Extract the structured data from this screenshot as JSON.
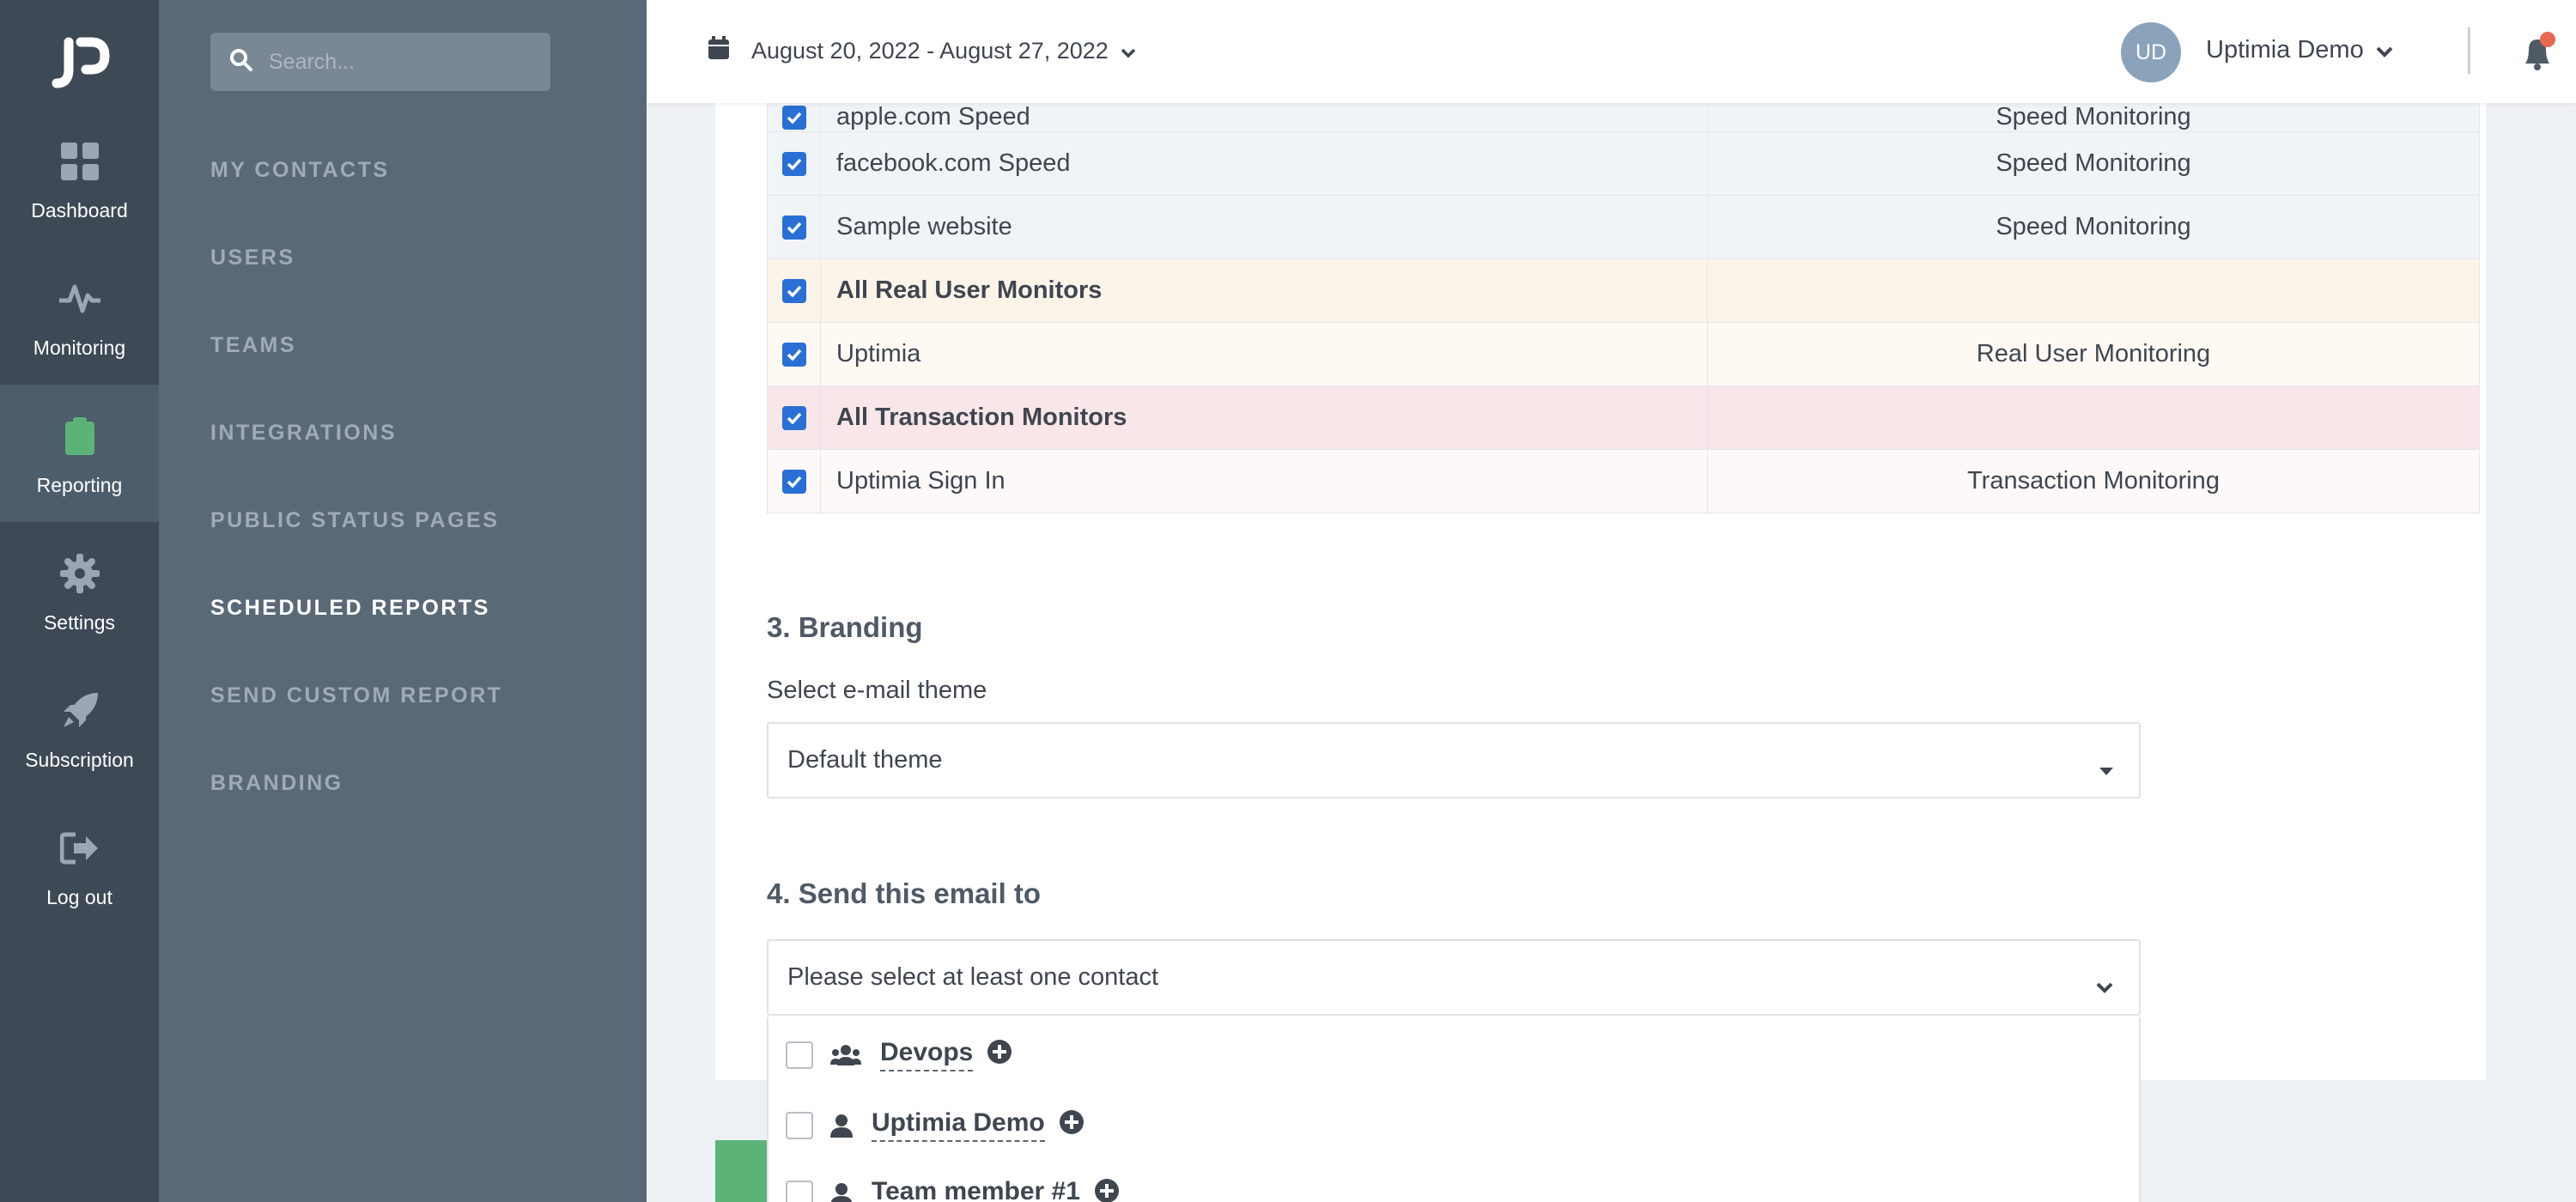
{
  "rail": {
    "items": [
      {
        "label": "Dashboard",
        "icon": "dashboard-icon"
      },
      {
        "label": "Monitoring",
        "icon": "pulse-icon"
      },
      {
        "label": "Reporting",
        "icon": "clipboard-icon"
      },
      {
        "label": "Settings",
        "icon": "gear-icon"
      },
      {
        "label": "Subscription",
        "icon": "rocket-icon"
      },
      {
        "label": "Log out",
        "icon": "logout-icon"
      }
    ],
    "active": "Reporting"
  },
  "search": {
    "placeholder": "Search..."
  },
  "subnav": {
    "items": [
      "MY CONTACTS",
      "USERS",
      "TEAMS",
      "INTEGRATIONS",
      "PUBLIC STATUS PAGES",
      "SCHEDULED REPORTS",
      "SEND CUSTOM REPORT",
      "BRANDING"
    ],
    "active": "SCHEDULED REPORTS"
  },
  "topbar": {
    "date_range": "August 20, 2022 - August 27, 2022",
    "avatar_initials": "UD",
    "user_name": "Uptimia Demo"
  },
  "monitors": {
    "rows": [
      {
        "name": "apple.com Speed",
        "type": "Speed Monitoring",
        "checked": true
      },
      {
        "name": "facebook.com Speed",
        "type": "Speed Monitoring",
        "checked": true
      },
      {
        "name": "Sample website",
        "type": "Speed Monitoring",
        "checked": true
      },
      {
        "name": "All Real User Monitors",
        "type": "",
        "checked": true
      },
      {
        "name": "Uptimia",
        "type": "Real User Monitoring",
        "checked": true
      },
      {
        "name": "All Transaction Monitors",
        "type": "",
        "checked": true
      },
      {
        "name": "Uptimia Sign In",
        "type": "Transaction Monitoring",
        "checked": true
      }
    ]
  },
  "branding": {
    "title": "3. Branding",
    "theme_label": "Select e-mail theme",
    "theme_value": "Default theme"
  },
  "send_to": {
    "title": "4. Send this email to",
    "placeholder": "Please select at least one contact",
    "options": [
      {
        "label": "Devops",
        "icon": "team-icon",
        "checked": false
      },
      {
        "label": "Uptimia Demo",
        "icon": "user-icon",
        "checked": false
      },
      {
        "label": "Team member #1",
        "icon": "user-icon",
        "checked": false
      }
    ]
  },
  "colors": {
    "rail_bg": "#3d4a56",
    "subnav_bg": "#5a6977",
    "accent_blue": "#2a6fd6",
    "notify_dot": "#e8674f",
    "reporting_icon": "#5cb377"
  }
}
